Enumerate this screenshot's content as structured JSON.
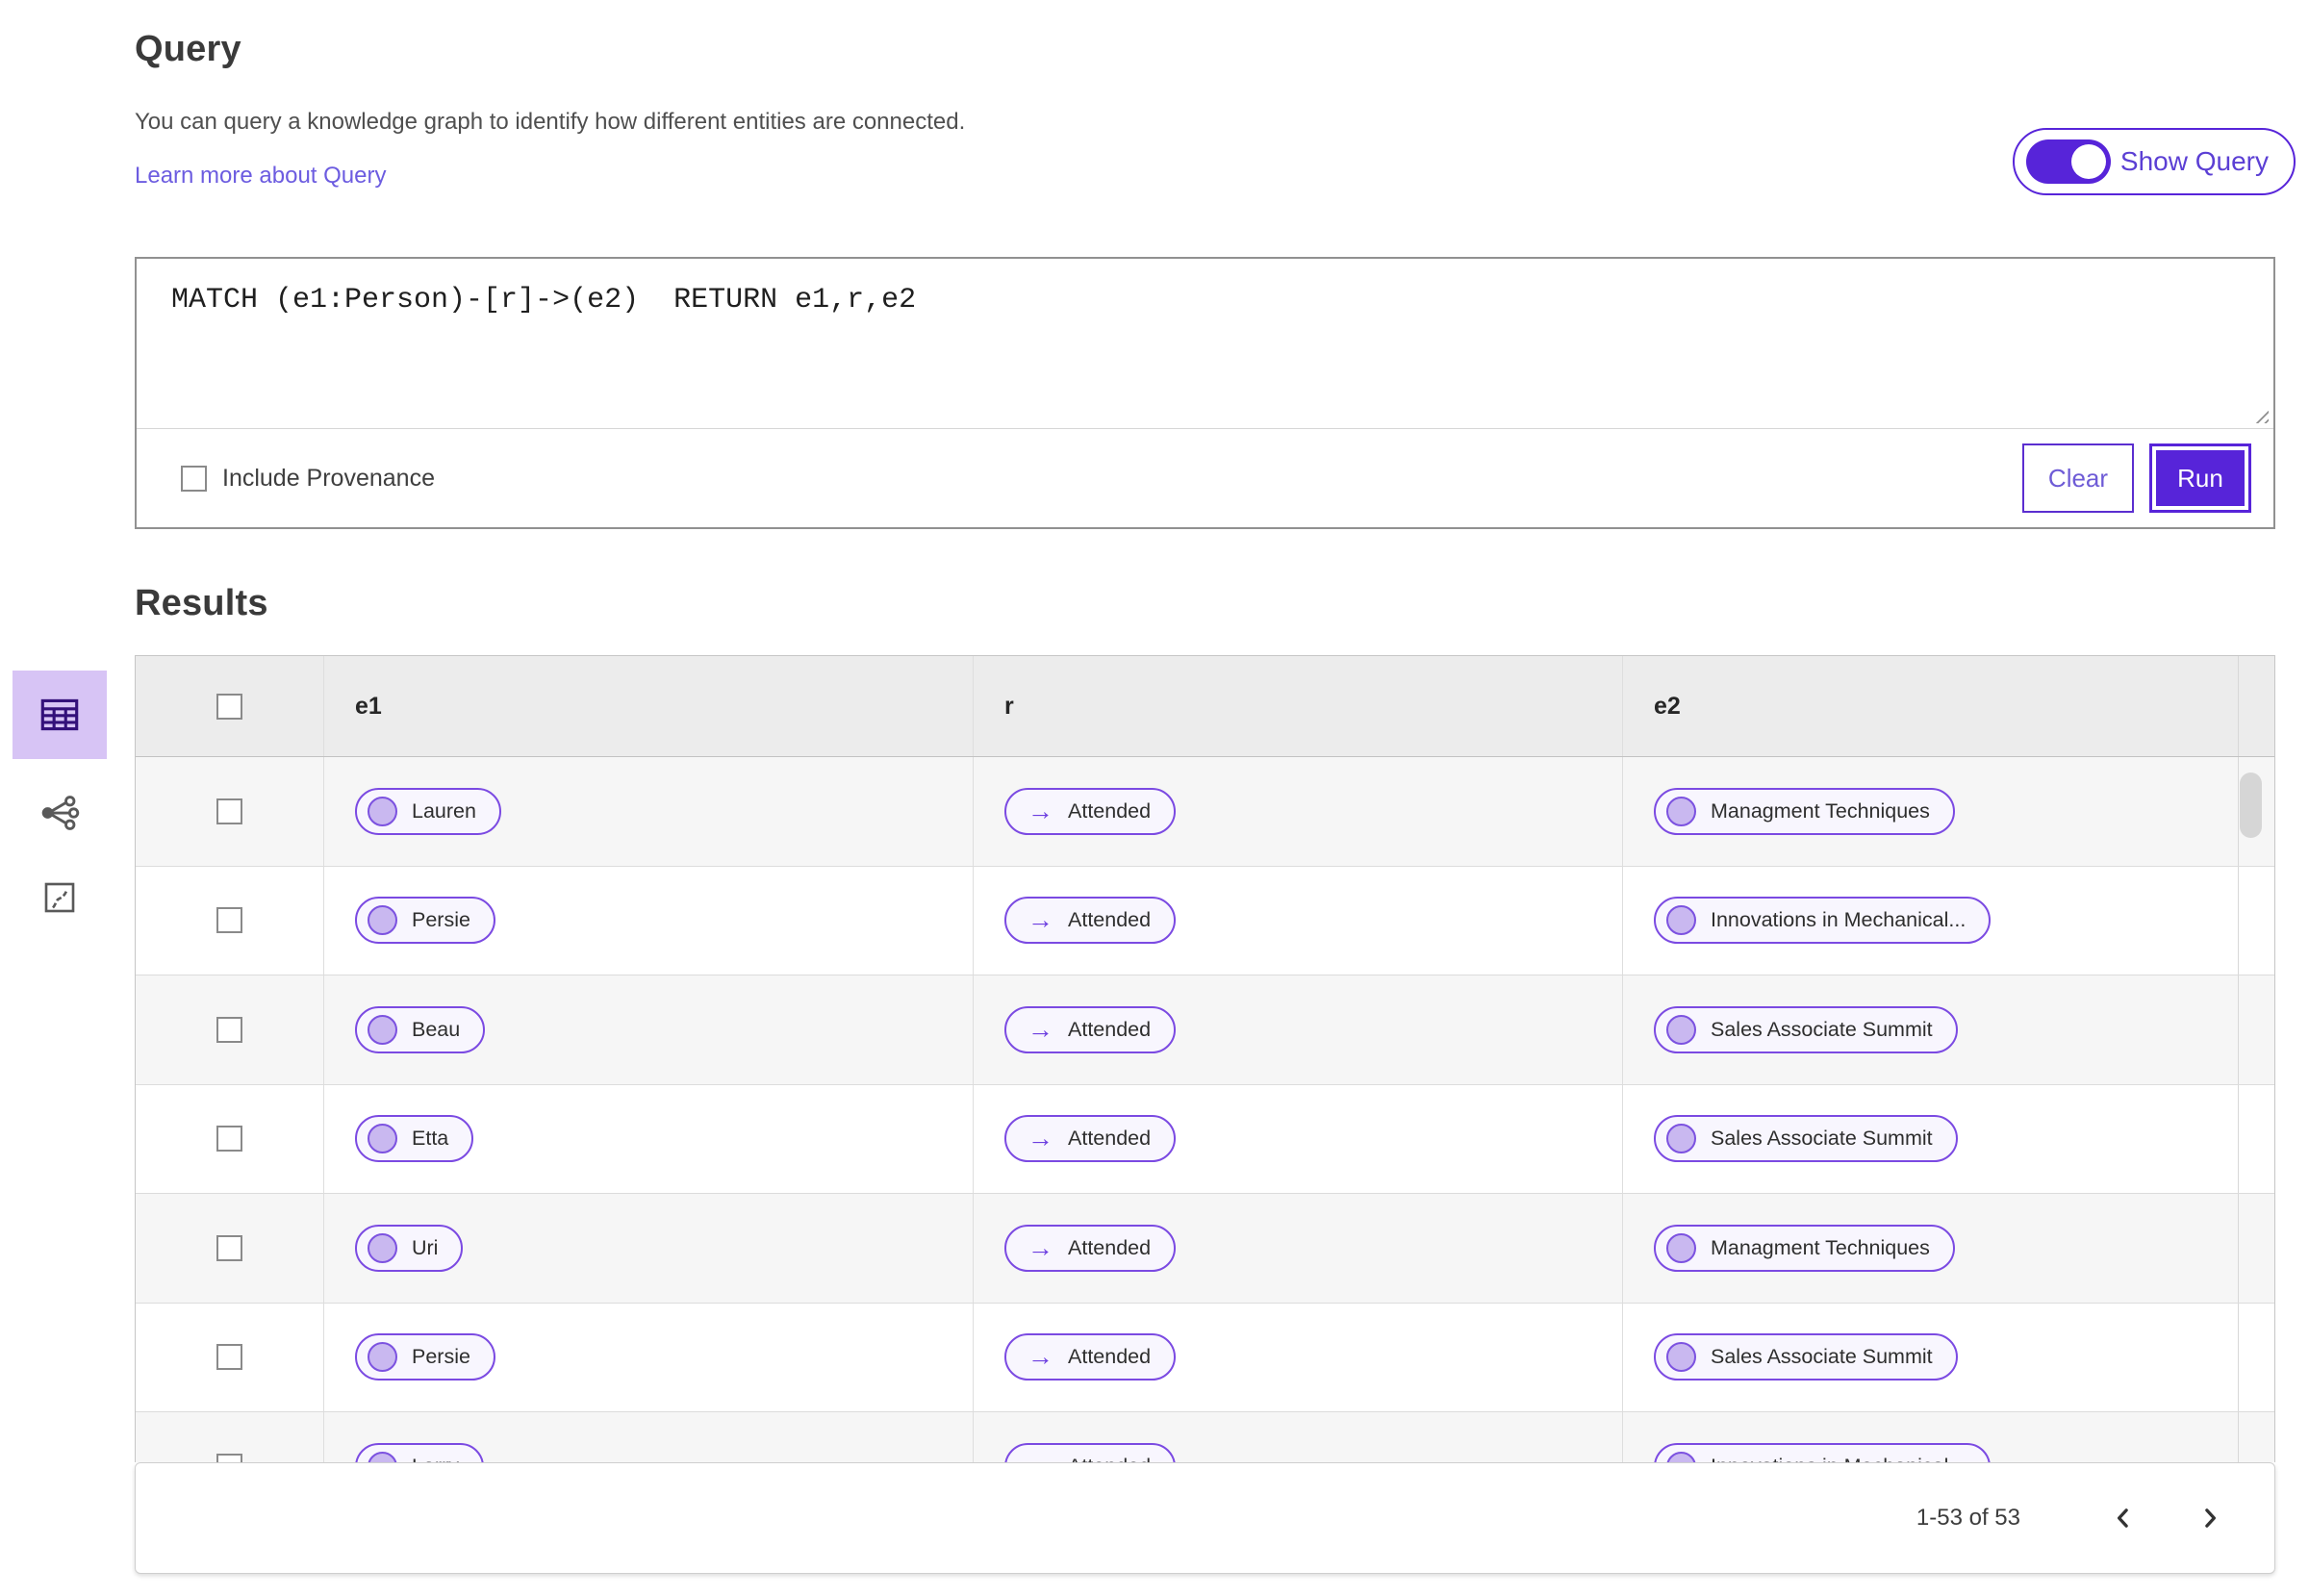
{
  "colors": {
    "accent_purple": "#5724d9",
    "pill_border_purple": "#7b4ae2",
    "selected_view_bg": "#d7c4f5",
    "link_purple": "#6c5ce0"
  },
  "icons": {
    "arrow_right": "→"
  },
  "query_section": {
    "title": "Query",
    "description": "You can query a knowledge graph to identify how different entities are connected.",
    "learn_more_link": "Learn more about Query",
    "show_query_toggle": {
      "label": "Show Query",
      "state": "on"
    },
    "editor": {
      "query_text": "MATCH (e1:Person)-[r]->(e2)  RETURN e1,r,e2"
    },
    "include_provenance": {
      "label": "Include Provenance",
      "checked": false
    },
    "buttons": {
      "clear": "Clear",
      "run": "Run"
    }
  },
  "results_section": {
    "title": "Results",
    "view_switcher": [
      {
        "name": "table-view-icon",
        "selected": true
      },
      {
        "name": "network-view-icon",
        "selected": false
      },
      {
        "name": "chart-view-icon",
        "selected": false
      }
    ],
    "table": {
      "columns": [
        "e1",
        "r",
        "e2"
      ],
      "rows": [
        {
          "e1": "Lauren",
          "r": "Attended",
          "e2": "Managment Techniques"
        },
        {
          "e1": "Persie",
          "r": "Attended",
          "e2": "Innovations in Mechanical..."
        },
        {
          "e1": "Beau",
          "r": "Attended",
          "e2": "Sales Associate Summit"
        },
        {
          "e1": "Etta",
          "r": "Attended",
          "e2": "Sales Associate Summit"
        },
        {
          "e1": "Uri",
          "r": "Attended",
          "e2": "Managment Techniques"
        },
        {
          "e1": "Persie",
          "r": "Attended",
          "e2": "Sales Associate Summit"
        },
        {
          "e1": "Larry",
          "r": "Attended",
          "e2": "Innovations in Mechanical..."
        }
      ]
    },
    "pagination": {
      "range": "1-53 of 53"
    }
  }
}
